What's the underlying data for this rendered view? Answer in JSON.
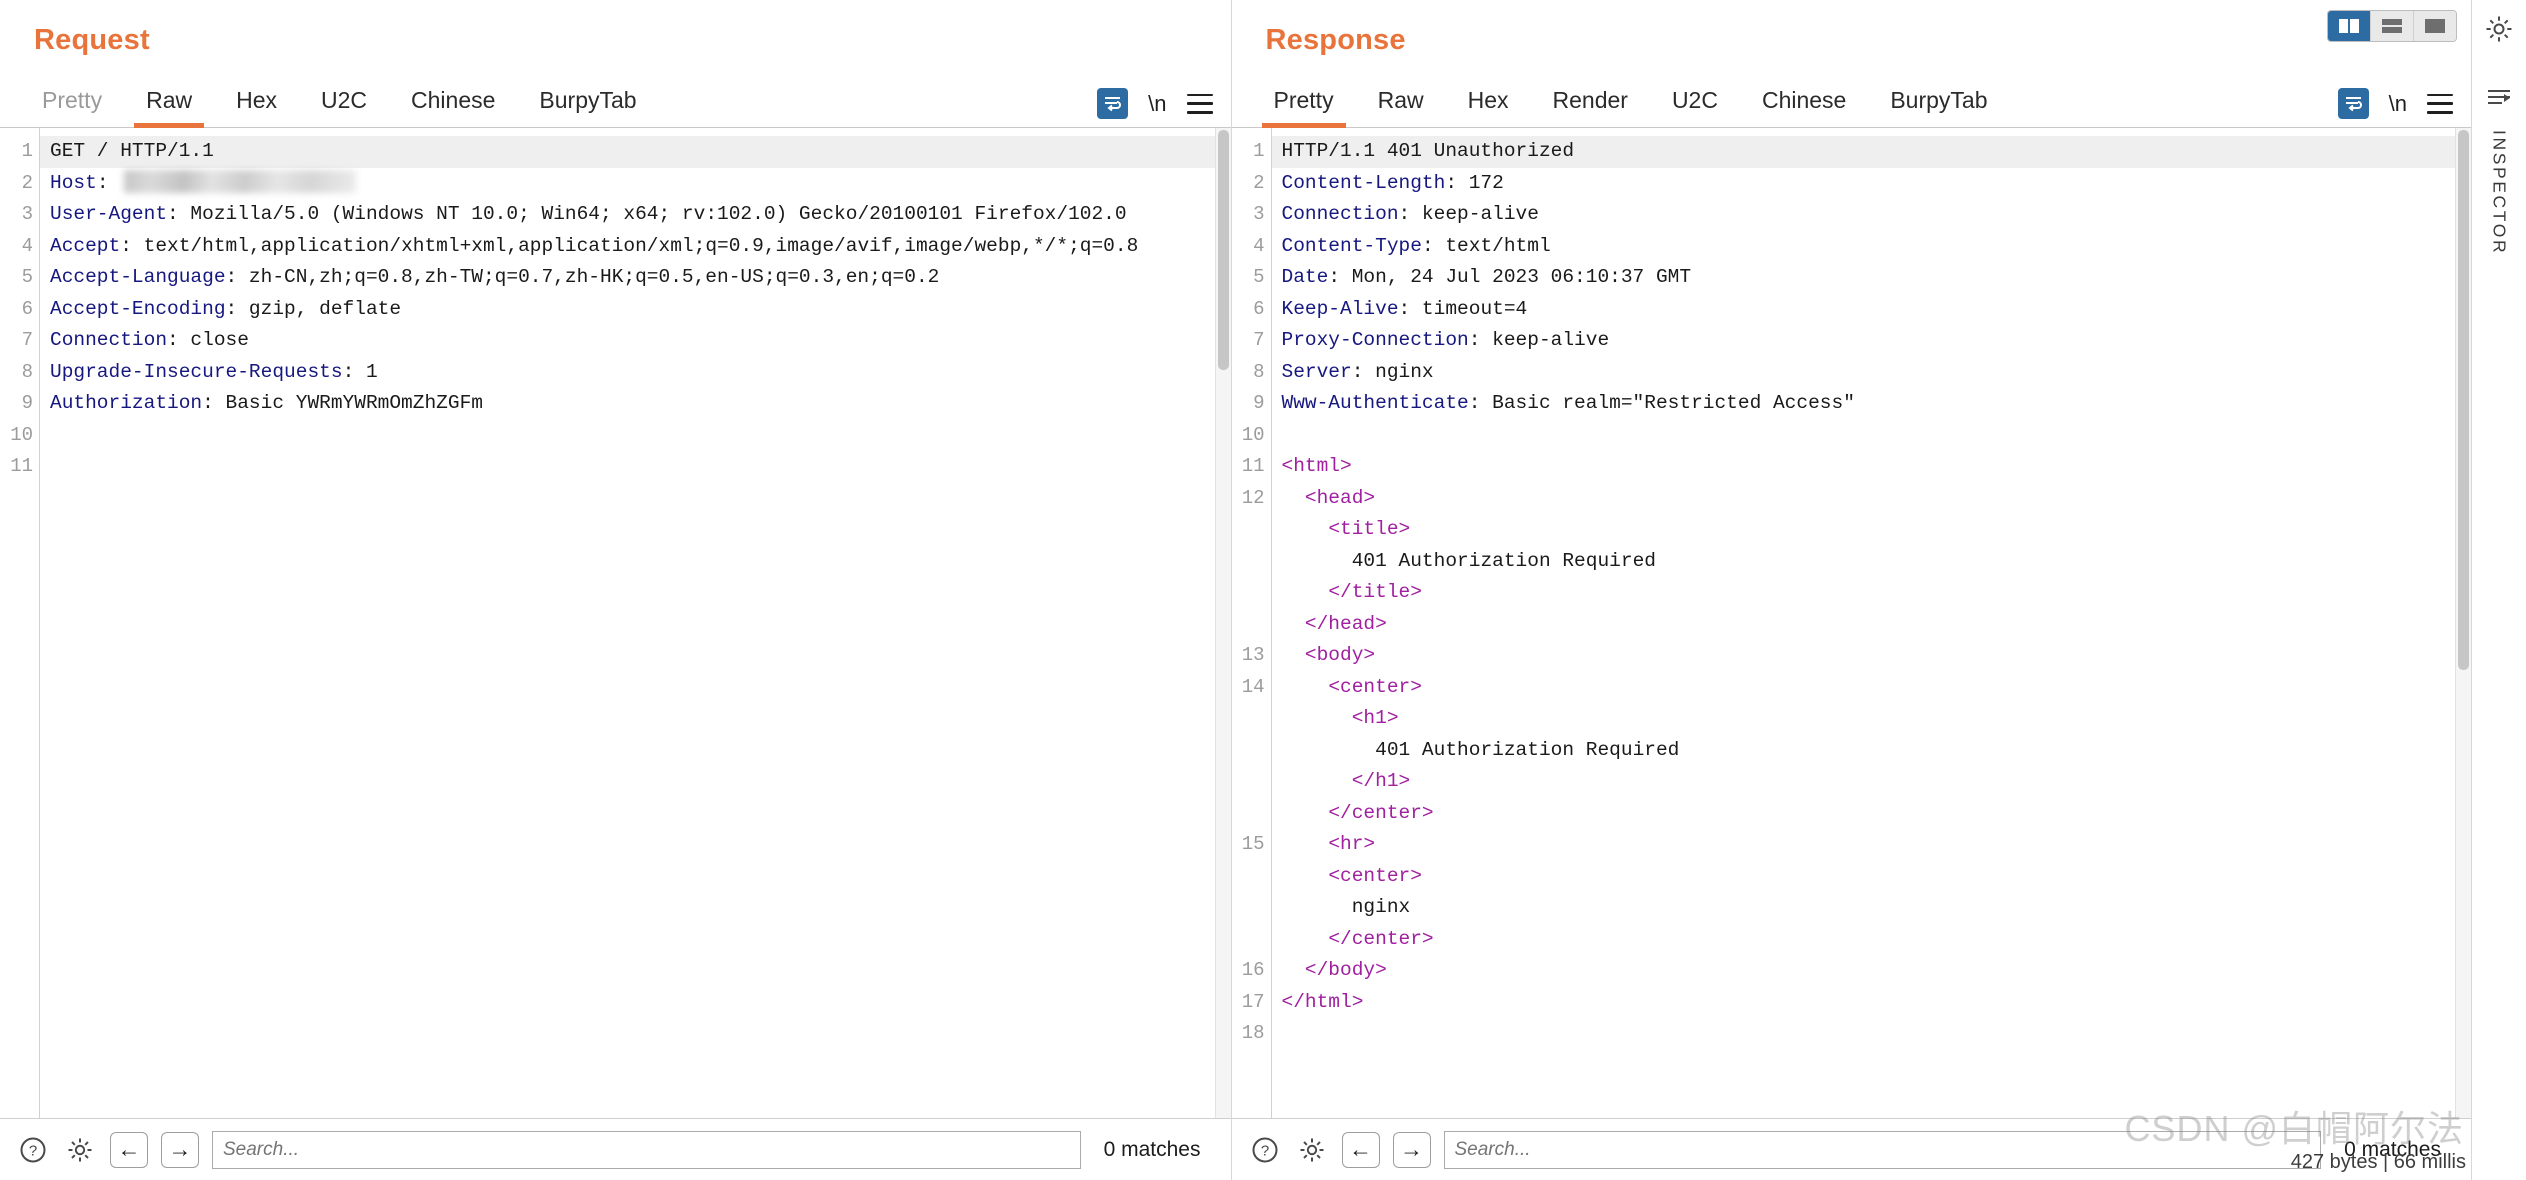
{
  "request": {
    "title": "Request",
    "tabs": [
      {
        "label": "Pretty",
        "active": false,
        "disabled": true
      },
      {
        "label": "Raw",
        "active": true,
        "disabled": false
      },
      {
        "label": "Hex",
        "active": false,
        "disabled": false
      },
      {
        "label": "U2C",
        "active": false,
        "disabled": false
      },
      {
        "label": "Chinese",
        "active": false,
        "disabled": false
      },
      {
        "label": "BurpyTab",
        "active": false,
        "disabled": false
      }
    ],
    "newline_label": "\\n",
    "lines": [
      {
        "num": "1",
        "highlight": true,
        "segments": [
          {
            "t": "GET / HTTP/1.1",
            "c": "plain"
          }
        ]
      },
      {
        "num": "2",
        "highlight": false,
        "segments": [
          {
            "t": "Host",
            "c": "hdr"
          },
          {
            "t": ": ",
            "c": "plain"
          },
          {
            "t": "",
            "c": "blur"
          }
        ]
      },
      {
        "num": "3",
        "highlight": false,
        "segments": [
          {
            "t": "User-Agent",
            "c": "hdr"
          },
          {
            "t": ": Mozilla/5.0 (Windows NT 10.0; Win64; x64; rv:102.0) Gecko/20100101 Firefox/102.0",
            "c": "plain"
          }
        ]
      },
      {
        "num": "4",
        "highlight": false,
        "segments": [
          {
            "t": "Accept",
            "c": "hdr"
          },
          {
            "t": ": text/html,application/xhtml+xml,application/xml;q=0.9,image/avif,image/webp,*/*;q=0.8",
            "c": "plain"
          }
        ]
      },
      {
        "num": "5",
        "highlight": false,
        "segments": [
          {
            "t": "Accept-Language",
            "c": "hdr"
          },
          {
            "t": ": zh-CN,zh;q=0.8,zh-TW;q=0.7,zh-HK;q=0.5,en-US;q=0.3,en;q=0.2",
            "c": "plain"
          }
        ]
      },
      {
        "num": "6",
        "highlight": false,
        "segments": [
          {
            "t": "Accept-Encoding",
            "c": "hdr"
          },
          {
            "t": ": gzip, deflate",
            "c": "plain"
          }
        ]
      },
      {
        "num": "7",
        "highlight": false,
        "segments": [
          {
            "t": "Connection",
            "c": "hdr"
          },
          {
            "t": ": close",
            "c": "plain"
          }
        ]
      },
      {
        "num": "8",
        "highlight": false,
        "segments": [
          {
            "t": "Upgrade-Insecure-Requests",
            "c": "hdr"
          },
          {
            "t": ": 1",
            "c": "plain"
          }
        ]
      },
      {
        "num": "9",
        "highlight": false,
        "segments": [
          {
            "t": "Authorization",
            "c": "hdr"
          },
          {
            "t": ": Basic YWRmYWRmOmZhZGFm",
            "c": "plain"
          }
        ]
      },
      {
        "num": "10",
        "highlight": false,
        "segments": []
      },
      {
        "num": "11",
        "highlight": false,
        "segments": []
      }
    ],
    "footer": {
      "search_placeholder": "Search...",
      "search_value": "",
      "matches": "0 matches",
      "back_arrow": "←",
      "forward_arrow": "→"
    }
  },
  "response": {
    "title": "Response",
    "tabs": [
      {
        "label": "Pretty",
        "active": true,
        "disabled": false
      },
      {
        "label": "Raw",
        "active": false,
        "disabled": false
      },
      {
        "label": "Hex",
        "active": false,
        "disabled": false
      },
      {
        "label": "Render",
        "active": false,
        "disabled": false
      },
      {
        "label": "U2C",
        "active": false,
        "disabled": false
      },
      {
        "label": "Chinese",
        "active": false,
        "disabled": false
      },
      {
        "label": "BurpyTab",
        "active": false,
        "disabled": false
      }
    ],
    "newline_label": "\\n",
    "lines": [
      {
        "num": "1",
        "highlight": true,
        "segments": [
          {
            "t": "HTTP/1.1 401 Unauthorized",
            "c": "plain"
          }
        ]
      },
      {
        "num": "2",
        "highlight": false,
        "segments": [
          {
            "t": "Content-Length",
            "c": "hdr"
          },
          {
            "t": ": 172",
            "c": "plain"
          }
        ]
      },
      {
        "num": "3",
        "highlight": false,
        "segments": [
          {
            "t": "Connection",
            "c": "hdr"
          },
          {
            "t": ": keep-alive",
            "c": "plain"
          }
        ]
      },
      {
        "num": "4",
        "highlight": false,
        "segments": [
          {
            "t": "Content-Type",
            "c": "hdr"
          },
          {
            "t": ": text/html",
            "c": "plain"
          }
        ]
      },
      {
        "num": "5",
        "highlight": false,
        "segments": [
          {
            "t": "Date",
            "c": "hdr"
          },
          {
            "t": ": Mon, 24 Jul 2023 06:10:37 GMT",
            "c": "plain"
          }
        ]
      },
      {
        "num": "6",
        "highlight": false,
        "segments": [
          {
            "t": "Keep-Alive",
            "c": "hdr"
          },
          {
            "t": ": timeout=4",
            "c": "plain"
          }
        ]
      },
      {
        "num": "7",
        "highlight": false,
        "segments": [
          {
            "t": "Proxy-Connection",
            "c": "hdr"
          },
          {
            "t": ": keep-alive",
            "c": "plain"
          }
        ]
      },
      {
        "num": "8",
        "highlight": false,
        "segments": [
          {
            "t": "Server",
            "c": "hdr"
          },
          {
            "t": ": nginx",
            "c": "plain"
          }
        ]
      },
      {
        "num": "9",
        "highlight": false,
        "segments": [
          {
            "t": "Www-Authenticate",
            "c": "hdr"
          },
          {
            "t": ": Basic realm=\"Restricted Access\"",
            "c": "plain"
          }
        ]
      },
      {
        "num": "10",
        "highlight": false,
        "segments": []
      },
      {
        "num": "11",
        "highlight": false,
        "segments": [
          {
            "t": "<html>",
            "c": "tag"
          }
        ]
      },
      {
        "num": "12",
        "highlight": false,
        "segments": [
          {
            "t": "  <head>",
            "c": "tag"
          }
        ]
      },
      {
        "num": "",
        "highlight": false,
        "segments": [
          {
            "t": "    <title>",
            "c": "tag"
          }
        ]
      },
      {
        "num": "",
        "highlight": false,
        "segments": [
          {
            "t": "      401 Authorization Required",
            "c": "plain"
          }
        ]
      },
      {
        "num": "",
        "highlight": false,
        "segments": [
          {
            "t": "    </title>",
            "c": "tag"
          }
        ]
      },
      {
        "num": "",
        "highlight": false,
        "segments": [
          {
            "t": "  </head>",
            "c": "tag"
          }
        ]
      },
      {
        "num": "13",
        "highlight": false,
        "segments": [
          {
            "t": "  <body>",
            "c": "tag"
          }
        ]
      },
      {
        "num": "14",
        "highlight": false,
        "segments": [
          {
            "t": "    <center>",
            "c": "tag"
          }
        ]
      },
      {
        "num": "",
        "highlight": false,
        "segments": [
          {
            "t": "      <h1>",
            "c": "tag"
          }
        ]
      },
      {
        "num": "",
        "highlight": false,
        "segments": [
          {
            "t": "        401 Authorization Required",
            "c": "plain"
          }
        ]
      },
      {
        "num": "",
        "highlight": false,
        "segments": [
          {
            "t": "      </h1>",
            "c": "tag"
          }
        ]
      },
      {
        "num": "",
        "highlight": false,
        "segments": [
          {
            "t": "    </center>",
            "c": "tag"
          }
        ]
      },
      {
        "num": "15",
        "highlight": false,
        "segments": [
          {
            "t": "    <hr>",
            "c": "tag"
          }
        ]
      },
      {
        "num": "",
        "highlight": false,
        "segments": [
          {
            "t": "    <center>",
            "c": "tag"
          }
        ]
      },
      {
        "num": "",
        "highlight": false,
        "segments": [
          {
            "t": "      nginx",
            "c": "plain"
          }
        ]
      },
      {
        "num": "",
        "highlight": false,
        "segments": [
          {
            "t": "    </center>",
            "c": "tag"
          }
        ]
      },
      {
        "num": "16",
        "highlight": false,
        "segments": [
          {
            "t": "  </body>",
            "c": "tag"
          }
        ]
      },
      {
        "num": "17",
        "highlight": false,
        "segments": [
          {
            "t": "</html>",
            "c": "tag"
          }
        ]
      },
      {
        "num": "18",
        "highlight": false,
        "segments": []
      }
    ],
    "footer": {
      "search_placeholder": "Search...",
      "search_value": "",
      "matches": "0 matches",
      "back_arrow": "←",
      "forward_arrow": "→"
    }
  },
  "rail": {
    "label": "INSPECTOR"
  },
  "status": {
    "text": "427 bytes | 66 millis",
    "watermark": "CSDN @白帽阿尔法"
  },
  "colors": {
    "accent": "#e8743b",
    "header_blue": "#16177f",
    "tag_purple": "#a020a0",
    "active_blue": "#2d6ca2"
  }
}
